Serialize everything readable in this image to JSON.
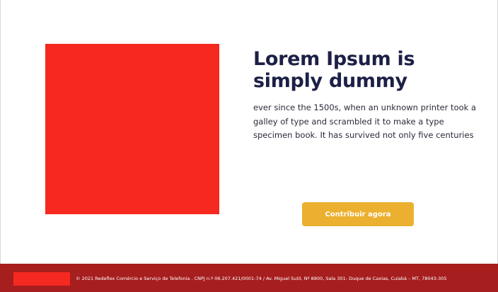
{
  "colors": {
    "image_placeholder": "#f5291f",
    "title": "#1c2046",
    "button_bg": "#ebb02f",
    "footer_bg": "#a71e1e",
    "footer_logo": "#f5291f"
  },
  "hero": {
    "image": "image-placeholder",
    "title": "Lorem Ipsum is simply dummy",
    "body": "ever since the 1500s, when an unknown printer took a galley of type and scrambled it to make a type specimen book. It has survived not only five centuries",
    "button_label": "Contribuir agora"
  },
  "footer": {
    "logo": "brand-logo",
    "copyright": "© 2021 Redeflex Comércio e Serviço de Telefonia . CNPJ n.º 06.207.421/0001-74 / Av. Miguel Sutil, Nº 8800, Sala 301- Duque de Caxias, Cuiabá – MT, 78043-305"
  }
}
